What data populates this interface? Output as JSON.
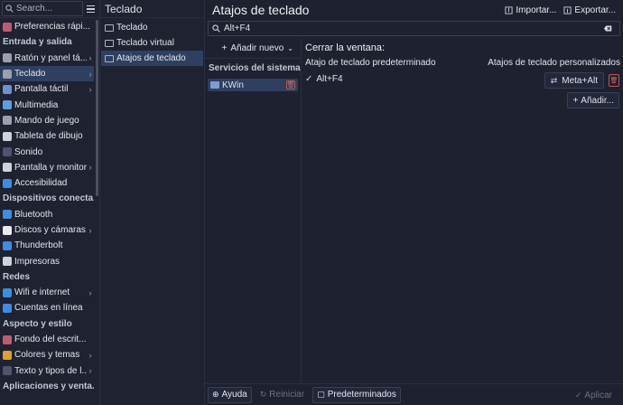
{
  "sidebar": {
    "search_placeholder": "Search...",
    "items": [
      {
        "type": "item",
        "label": "Preferencias rápi...",
        "icon": "quick-settings-icon",
        "color": "#c05a72",
        "chevron": false
      },
      {
        "type": "section",
        "label": "Entrada y salida"
      },
      {
        "type": "item",
        "label": "Ratón y panel tá...",
        "icon": "mouse-icon",
        "color": "#9aa0b0",
        "chevron": true
      },
      {
        "type": "item",
        "label": "Teclado",
        "icon": "keyboard-icon",
        "color": "#9aa0b0",
        "chevron": true,
        "active": true
      },
      {
        "type": "item",
        "label": "Pantalla táctil",
        "icon": "touchscreen-icon",
        "color": "#6e8fd0",
        "chevron": true
      },
      {
        "type": "item",
        "label": "Multimedia",
        "icon": "multimedia-icon",
        "color": "#5aa0e0",
        "chevron": false
      },
      {
        "type": "item",
        "label": "Mando de juego",
        "icon": "gamepad-icon",
        "color": "#9aa0b0",
        "chevron": false
      },
      {
        "type": "item",
        "label": "Tableta de dibujo",
        "icon": "tablet-icon",
        "color": "#cfd2dc",
        "chevron": false
      },
      {
        "type": "item",
        "label": "Sonido",
        "icon": "speaker-icon",
        "color": "#50546a",
        "chevron": false
      },
      {
        "type": "item",
        "label": "Pantalla y monitor",
        "icon": "monitor-icon",
        "color": "#cfd2dc",
        "chevron": true
      },
      {
        "type": "item",
        "label": "Accesibilidad",
        "icon": "accessibility-icon",
        "color": "#3d8de0",
        "chevron": false
      },
      {
        "type": "section",
        "label": "Dispositivos conecta..."
      },
      {
        "type": "item",
        "label": "Bluetooth",
        "icon": "bluetooth-icon",
        "color": "#3d8de0",
        "chevron": false
      },
      {
        "type": "item",
        "label": "Discos y cámaras",
        "icon": "disks-icon",
        "color": "#e8e8ee",
        "chevron": true
      },
      {
        "type": "item",
        "label": "Thunderbolt",
        "icon": "thunderbolt-icon",
        "color": "#3d8de0",
        "chevron": false
      },
      {
        "type": "item",
        "label": "Impresoras",
        "icon": "printer-icon",
        "color": "#cfd2dc",
        "chevron": false
      },
      {
        "type": "section",
        "label": "Redes"
      },
      {
        "type": "item",
        "label": "Wifi e internet",
        "icon": "wifi-icon",
        "color": "#3d8de0",
        "chevron": true
      },
      {
        "type": "item",
        "label": "Cuentas en línea",
        "icon": "online-accounts-icon",
        "color": "#3d8de0",
        "chevron": false
      },
      {
        "type": "section",
        "label": "Aspecto y estilo"
      },
      {
        "type": "item",
        "label": "Fondo del escrit...",
        "icon": "wallpaper-icon",
        "color": "#c05a72",
        "chevron": false
      },
      {
        "type": "item",
        "label": "Colores y temas",
        "icon": "colors-icon",
        "color": "#e0a030",
        "chevron": true
      },
      {
        "type": "item",
        "label": "Texto y tipos de l...",
        "icon": "fonts-icon",
        "color": "#50546a",
        "chevron": true
      },
      {
        "type": "section",
        "label": "Aplicaciones y venta..."
      }
    ]
  },
  "middle": {
    "title": "Teclado",
    "items": [
      {
        "label": "Teclado",
        "icon": "keyboard-icon",
        "active": false
      },
      {
        "label": "Teclado virtual",
        "icon": "virtual-keyboard-icon",
        "active": false
      },
      {
        "label": "Atajos de teclado",
        "icon": "shortcuts-icon",
        "active": true
      }
    ]
  },
  "main": {
    "title": "Atajos de teclado",
    "import_label": "Importar...",
    "export_label": "Exportar...",
    "filter_value": "Alt+F4",
    "add_new_label": "Añadir nuevo",
    "services_header": "Servicios del sistema",
    "services": [
      {
        "label": "KWin"
      }
    ],
    "action_title": "Cerrar la ventana:",
    "default_header": "Atajo de teclado predeterminado",
    "custom_header": "Atajos de teclado personalizados",
    "default_shortcut": "Alt+F4",
    "custom_shortcut": "Meta+Alt",
    "add_label": "Añadir..."
  },
  "footer": {
    "help_label": "Ayuda",
    "reset_label": "Reiniciar",
    "defaults_label": "Predeterminados",
    "apply_label": "Aplicar"
  }
}
